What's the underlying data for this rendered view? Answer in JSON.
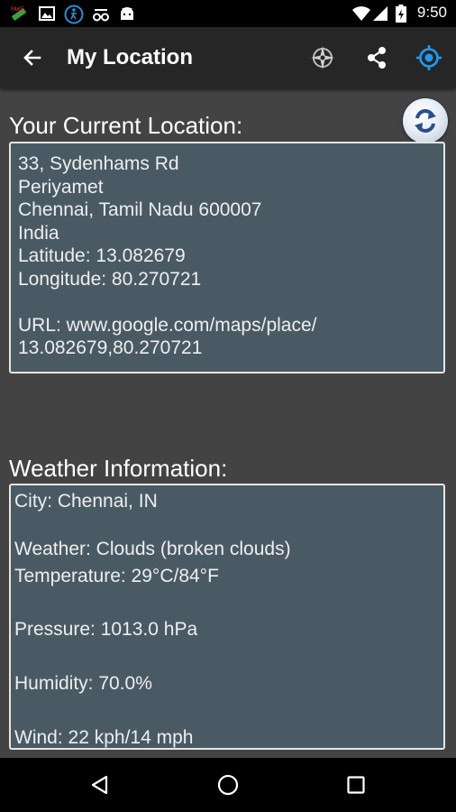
{
  "status_bar": {
    "time": "9:50",
    "icons": [
      "app-notification-icon",
      "image-icon",
      "accessibility-icon",
      "glasses-icon",
      "android-icon",
      "wifi-icon",
      "signal-icon",
      "battery-icon"
    ]
  },
  "toolbar": {
    "title": "My Location",
    "actions": [
      "compass-icon",
      "share-icon",
      "locate-icon"
    ],
    "accent_color": "#1e9bf0"
  },
  "location": {
    "title": "Your Current Location:",
    "lines": [
      "33, Sydenhams Rd",
      "Periyamet",
      "Chennai, Tamil Nadu 600007",
      "India",
      "Latitude: 13.082679",
      "Longitude: 80.270721",
      "",
      "URL: www.google.com/maps/place/",
      "13.082679,80.270721"
    ]
  },
  "weather": {
    "title": "Weather Information:",
    "city": "City: Chennai, IN",
    "condition": "Weather: Clouds (broken clouds)",
    "temperature": "Temperature: 29°C/84°F",
    "pressure": "Pressure: 1013.0 hPa",
    "humidity": "Humidity: 70.0%",
    "wind": "Wind: 22 kph/14 mph"
  },
  "colors": {
    "background": "#434343",
    "toolbar": "#262626",
    "box": "#4a5a65",
    "box_border": "#e6e6e6"
  }
}
